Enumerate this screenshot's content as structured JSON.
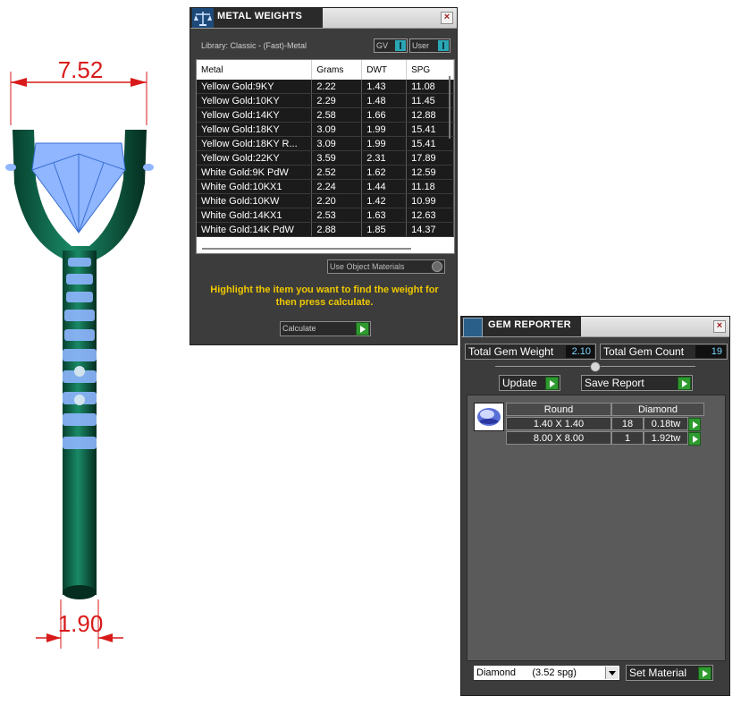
{
  "ring": {
    "top_dimension": "7.52",
    "bottom_dimension": "1.90",
    "dimension_color": "#d81a1a",
    "metal_color": "#0d6b4f",
    "gem_color": "#8fb6ff"
  },
  "metal_weights": {
    "title": "METAL WEIGHTS",
    "logo_icon": "scale-icon",
    "library_text": "Library: Classic - (Fast)-Metal",
    "toggle_gv": "GV",
    "toggle_user": "User",
    "columns": [
      "Metal",
      "Grams",
      "DWT",
      "SPG"
    ],
    "rows": [
      [
        "Yellow Gold:9KY",
        "2.22",
        "1.43",
        "11.08"
      ],
      [
        "Yellow Gold:10KY",
        "2.29",
        "1.48",
        "11.45"
      ],
      [
        "Yellow Gold:14KY",
        "2.58",
        "1.66",
        "12.88"
      ],
      [
        "Yellow Gold:18KY",
        "3.09",
        "1.99",
        "15.41"
      ],
      [
        "Yellow Gold:18KY R...",
        "3.09",
        "1.99",
        "15.41"
      ],
      [
        "Yellow Gold:22KY",
        "3.59",
        "2.31",
        "17.89"
      ],
      [
        "White Gold:9K PdW",
        "2.52",
        "1.62",
        "12.59"
      ],
      [
        "White Gold:10KX1",
        "2.24",
        "1.44",
        "11.18"
      ],
      [
        "White Gold:10KW",
        "2.20",
        "1.42",
        "10.99"
      ],
      [
        "White Gold:14KX1",
        "2.53",
        "1.63",
        "12.63"
      ],
      [
        "White Gold:14K PdW",
        "2.88",
        "1.85",
        "14.37"
      ]
    ],
    "use_object_materials": "Use Object Materials",
    "hint": "Highlight the item you want to find the weight for then press calculate.",
    "calculate_label": "Calculate",
    "accent_yellow": "#f0c800"
  },
  "gem_reporter": {
    "title": "GEM REPORTER",
    "logo_icon": "gem-report-icon",
    "total_weight_label": "Total Gem Weight",
    "total_weight_value": "2.10",
    "total_count_label": "Total Gem Count",
    "total_count_value": "19",
    "update_label": "Update",
    "save_report_label": "Save Report",
    "header_shape": "Round",
    "header_material": "Diamond",
    "rows": [
      {
        "size": "1.40 X 1.40",
        "count": "18",
        "weight": "0.18tw"
      },
      {
        "size": "8.00 X 8.00",
        "count": "1",
        "weight": "1.92tw"
      }
    ],
    "material_select": "Diamond      (3.52 spg)",
    "set_material_label": "Set Material"
  }
}
